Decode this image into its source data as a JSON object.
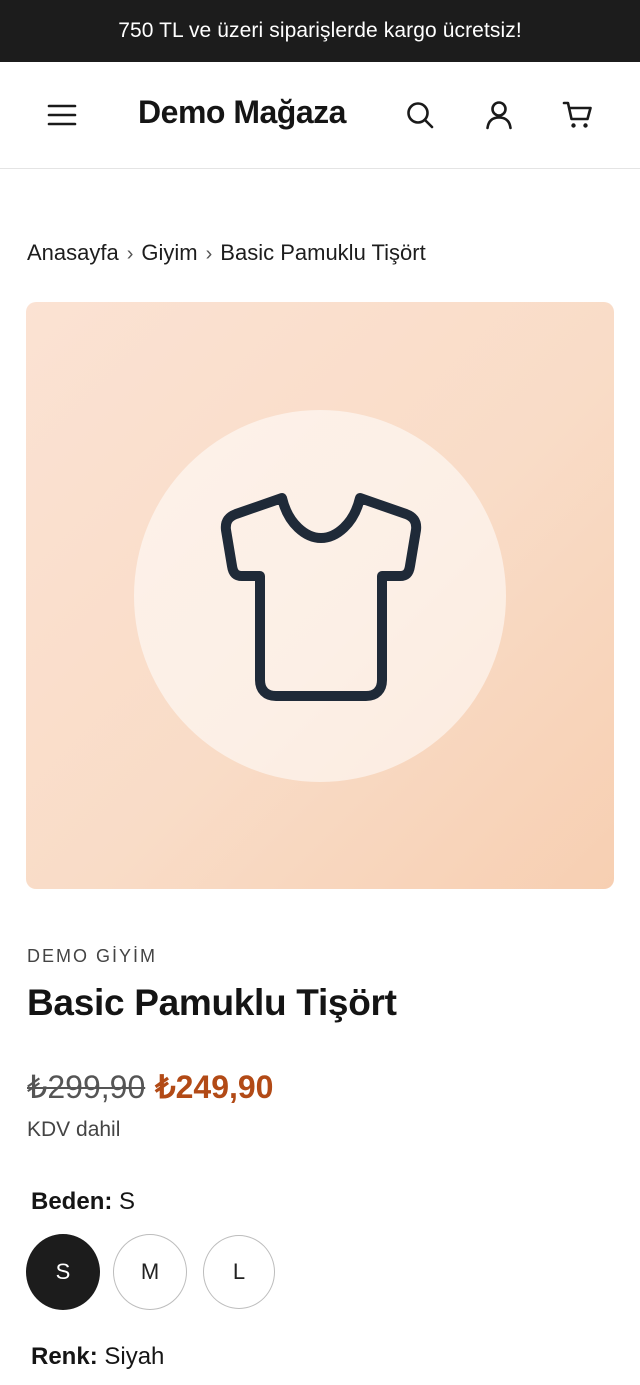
{
  "announcement": "750 TL ve üzeri siparişlerde kargo ücretsiz!",
  "header": {
    "logo": "Demo Mağaza",
    "icons": [
      "menu-icon",
      "search-icon",
      "user-icon",
      "cart-icon"
    ]
  },
  "breadcrumb": {
    "items": [
      "Anasayfa",
      "Giyim",
      "Basic Pamuklu Tişört"
    ],
    "separator": "›"
  },
  "gallery": {
    "icon": "tshirt-icon",
    "colors": {
      "bg_start": "#fbe2d3",
      "bg_end": "#f7cfb2",
      "icon_stroke": "#1f2a38"
    }
  },
  "product": {
    "brand": "DEMO GİYİM",
    "title": "Basic Pamuklu Tişört",
    "old_price": "₺299,90",
    "price": "₺249,90",
    "tax_note": "KDV dahil",
    "price_color": "#b24a16"
  },
  "options": {
    "size": {
      "label": "Beden:",
      "selected": "S",
      "values": [
        "S",
        "M",
        "L"
      ]
    },
    "color": {
      "label": "Renk:",
      "selected": "Siyah"
    }
  }
}
